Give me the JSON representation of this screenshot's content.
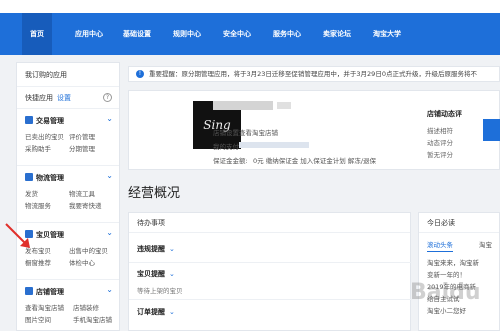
{
  "nav": {
    "items": [
      "首页",
      "应用中心",
      "基础设置",
      "规则中心",
      "安全中心",
      "服务中心",
      "卖家论坛",
      "淘宝大学"
    ]
  },
  "sidebar": {
    "my_apps": "我订购的应用",
    "quick_label": "快捷应用",
    "quick_setting": "设置",
    "groups": [
      {
        "title": "交易管理",
        "links": [
          "已卖出的宝贝",
          "评价管理",
          "采购助手",
          "分期管理"
        ]
      },
      {
        "title": "物流管理",
        "links": [
          "发货",
          "物流工具",
          "物流服务",
          "我要寄快递"
        ]
      },
      {
        "title": "宝贝管理",
        "links": [
          "发布宝贝",
          "出售中的宝贝",
          "橱窗推荐",
          "体检中心"
        ]
      },
      {
        "title": "店铺管理",
        "links": [
          "查看淘宝店铺",
          "店铺装修",
          "图片空间",
          "手机淘宝店铺"
        ]
      }
    ]
  },
  "notice": {
    "text": "重要提醒：原分期管理应用，将于3月23日迁移至促销管理应用中，并于3月29日0点正式升级，升级后原服务将不"
  },
  "shop": {
    "logo_text": "Sing",
    "shop_settings": "店铺设置",
    "view_shop": "查看淘宝店铺",
    "my_payment": "我的支付",
    "deposit": "保证金金额:",
    "deposit_links": "0元 缴纳保证金 加入保证金计划 解冻/退保",
    "dynamic_title": "店铺动态评",
    "desc_match": "描述相符",
    "score_label": "动态评分",
    "no_score": "暂无评分"
  },
  "overview": {
    "title": "经营概况"
  },
  "todo": {
    "title": "待办事项",
    "violation": "违规提醒",
    "items": "宝贝提醒",
    "waiting": "等待上架的宝贝",
    "orders": "订单提醒"
  },
  "news": {
    "title": "今日必读",
    "tab_active": "滚动头条",
    "tab_other": "淘宝",
    "line1": "淘宝来来，淘宝新",
    "line2": "变新一年的！",
    "line3": "2019年的电商新",
    "line4": "给自主试试",
    "line5": "淘宝小二您好"
  },
  "watermark": "Baidu"
}
